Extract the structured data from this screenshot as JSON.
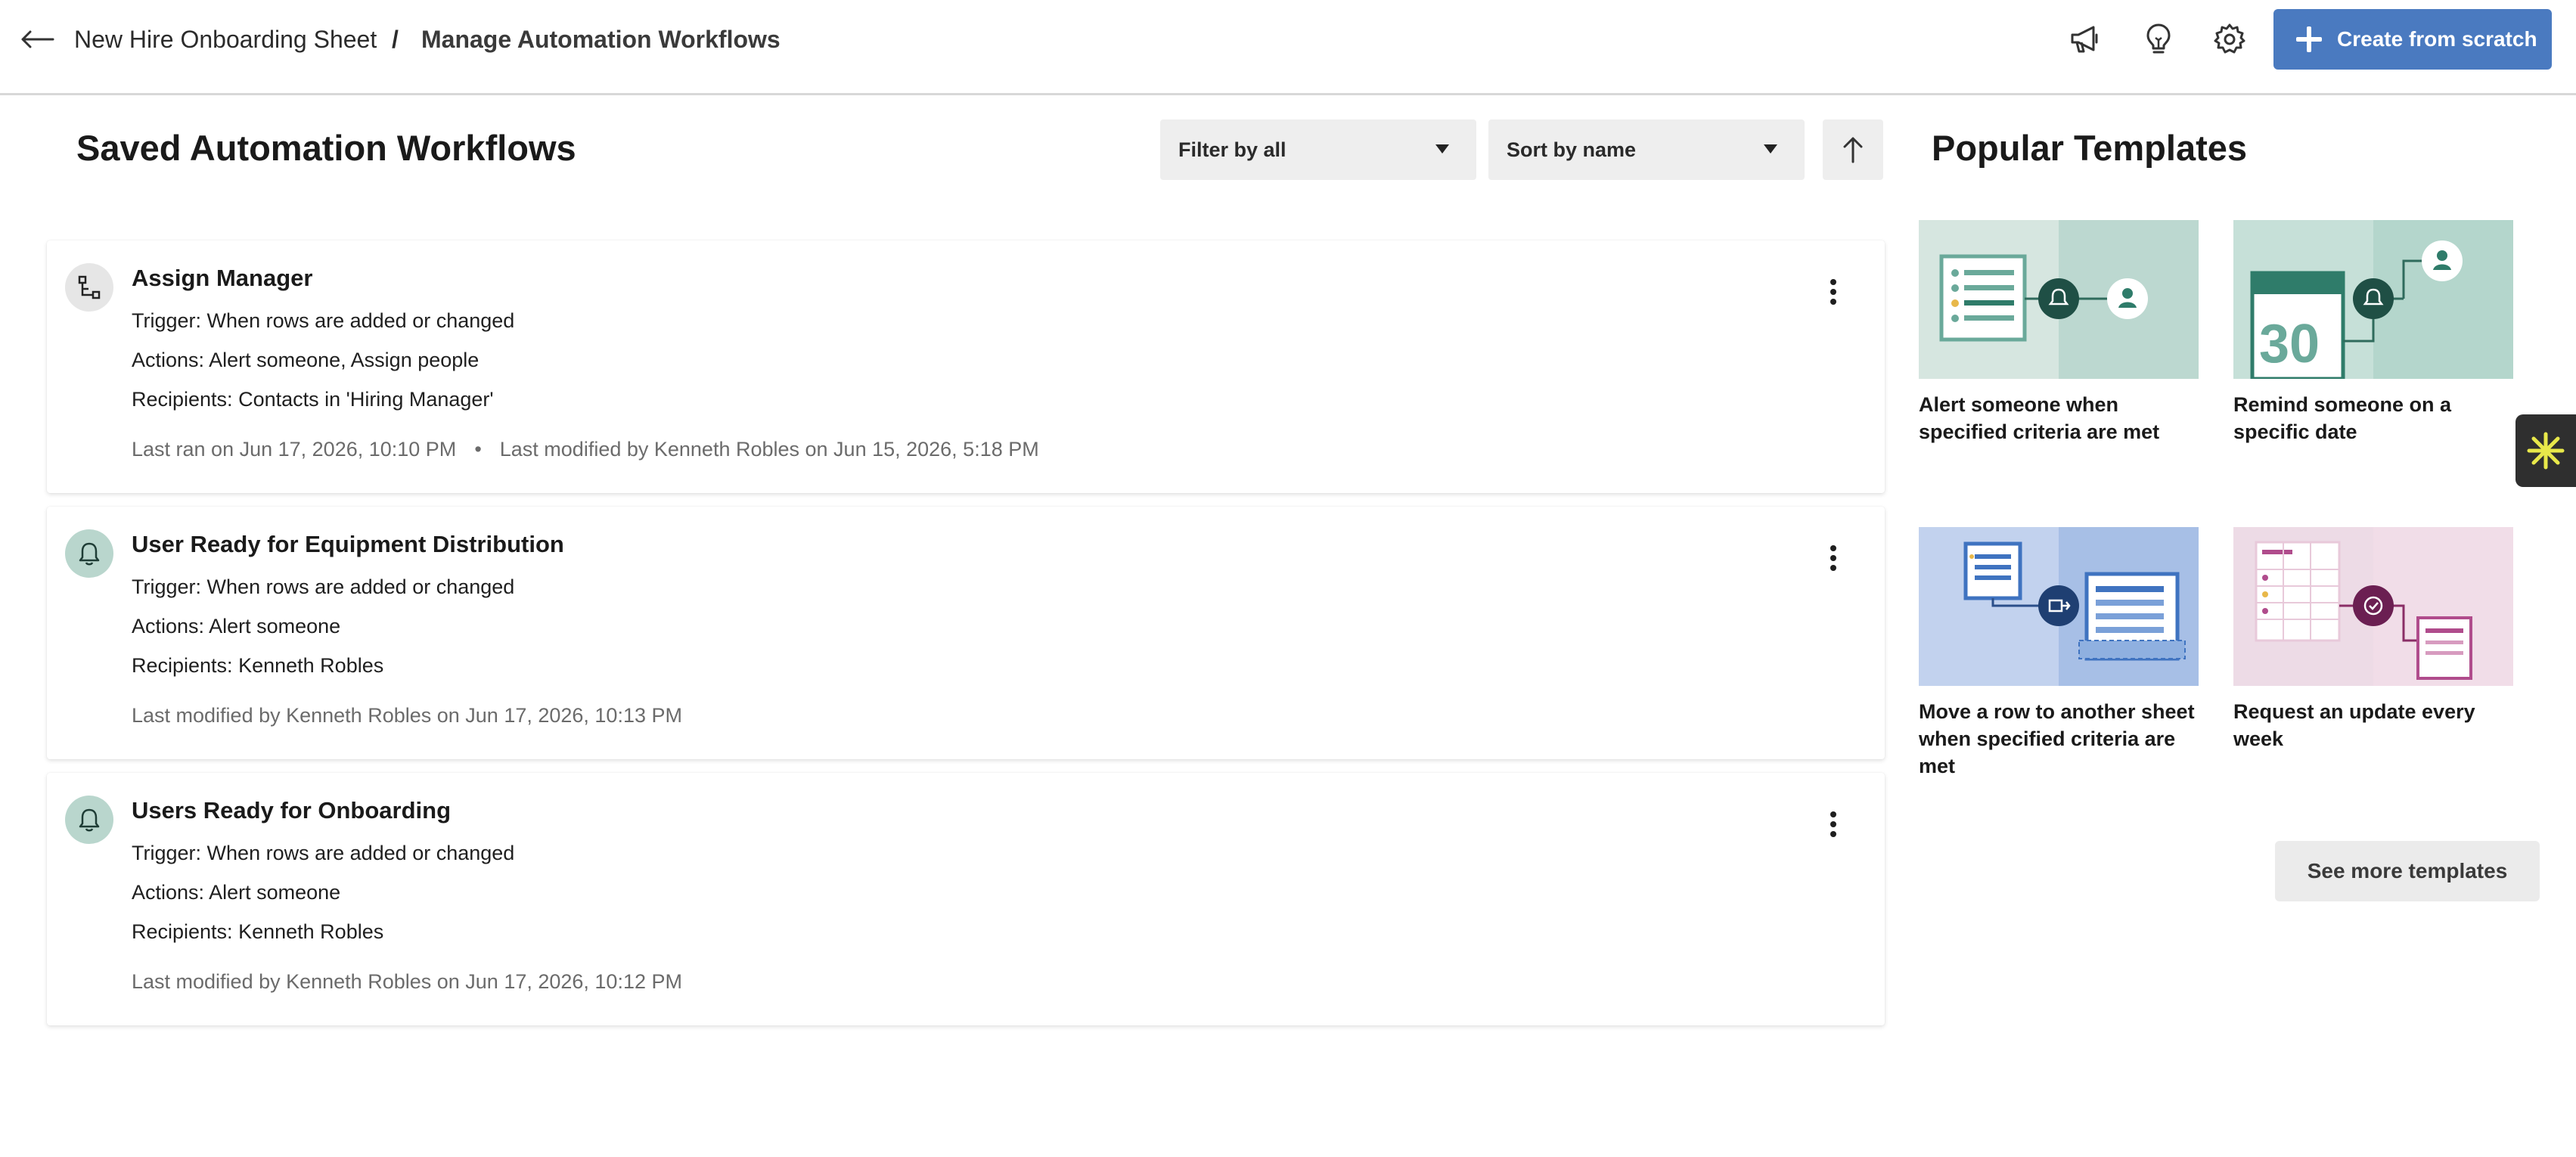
{
  "header": {
    "breadcrumb_sheet": "New Hire Onboarding Sheet",
    "breadcrumb_separator": "/",
    "breadcrumb_page": "Manage Automation Workflows",
    "create_label": "Create from scratch",
    "accent_color": "#4a7ac0"
  },
  "saved": {
    "title": "Saved Automation Workflows",
    "filter_label": "Filter by all",
    "sort_label": "Sort by name",
    "workflows": [
      {
        "name": "Assign Manager",
        "icon": "workflow-branch-icon",
        "trigger_key": "Trigger:",
        "trigger": "When rows are added or changed",
        "actions_key": "Actions:",
        "actions": "Alert someone, Assign people",
        "recipients_key": "Recipients:",
        "recipients": "Contacts in 'Hiring Manager'",
        "last_ran": "Last ran on Jun 17, 2026, 10:10 PM",
        "separator": "•",
        "last_modified": "Last modified by Kenneth Robles on Jun 15, 2026, 5:18 PM"
      },
      {
        "name": "User Ready for Equipment Distribution",
        "icon": "bell-icon",
        "trigger_key": "Trigger:",
        "trigger": "When rows are added or changed",
        "actions_key": "Actions:",
        "actions": "Alert someone",
        "recipients_key": "Recipients:",
        "recipients": "Kenneth Robles",
        "last_modified": "Last modified by Kenneth Robles on Jun 17, 2026, 10:13 PM"
      },
      {
        "name": "Users Ready for Onboarding",
        "icon": "bell-icon",
        "trigger_key": "Trigger:",
        "trigger": "When rows are added or changed",
        "actions_key": "Actions:",
        "actions": "Alert someone",
        "recipients_key": "Recipients:",
        "recipients": "Kenneth Robles",
        "last_modified": "Last modified by Kenneth Robles on Jun 17, 2026, 10:12 PM"
      }
    ]
  },
  "templates": {
    "title": "Popular Templates",
    "items": [
      {
        "label": "Alert someone when specified criteria are met"
      },
      {
        "label": "Remind someone on a specific date",
        "calendar_number": "30"
      },
      {
        "label": "Move a row to another sheet when specified criteria are met"
      },
      {
        "label": "Request an update every week"
      }
    ],
    "more_label": "See more templates"
  }
}
